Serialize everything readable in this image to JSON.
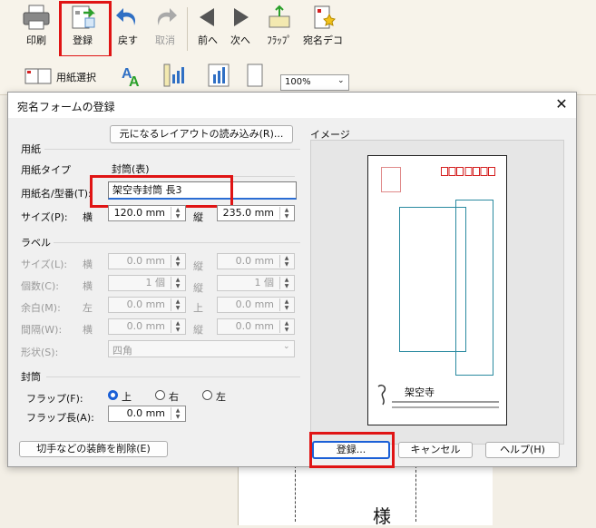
{
  "toolbar": {
    "print": "印刷",
    "register": "登録",
    "undo": "戻す",
    "cancel": "取消",
    "prev": "前へ",
    "next": "次へ",
    "flap": "ﾌﾗｯﾌﾟ",
    "deco": "宛名デコ",
    "paper_select": "用紙選択",
    "zoom": "100%"
  },
  "dialog": {
    "title": "宛名フォームの登録",
    "load_layout_button": "元になるレイアウトの読み込み(R)...",
    "image_label": "イメージ",
    "paper": {
      "group": "用紙",
      "type_label": "用紙タイプ",
      "type_value": "封筒(表)",
      "name_label": "用紙名/型番(T):",
      "name_value": "架空寺封筒 長3",
      "size_label": "サイズ(P):",
      "w_label": "横",
      "w_value": "120.0 mm",
      "h_label": "縦",
      "h_value": "235.0 mm"
    },
    "label": {
      "group": "ラベル",
      "size_label": "サイズ(L):",
      "count_label": "個数(C):",
      "margin_label": "余白(M):",
      "gap_label": "間隔(W):",
      "shape_label": "形状(S):",
      "yoko": "横",
      "tate": "縦",
      "left": "左",
      "top": "上",
      "size_w": "0.0 mm",
      "size_h": "0.0 mm",
      "count_w": "1 個",
      "count_h": "1 個",
      "margin_l": "0.0 mm",
      "margin_t": "0.0 mm",
      "gap_w": "0.0 mm",
      "gap_h": "0.0 mm",
      "shape_value": "四角"
    },
    "envelope": {
      "group": "封筒",
      "flap_label": "フラップ(F):",
      "opt_top": "上",
      "opt_right": "右",
      "opt_left": "左",
      "flap_len_label": "フラップ長(A):",
      "flap_len_value": "0.0 mm"
    },
    "remove_deco_button": "切手などの装飾を削除(E)",
    "register_button": "登録...",
    "cancel_button": "キャンセル",
    "help_button": "ヘルプ(H)",
    "preview_sender_text": "架空寺"
  },
  "background": {
    "sama": "様"
  },
  "colors": {
    "accent": "#1a5fd6",
    "highlight": "#e01414",
    "postal_box": "#d42020",
    "frame": "#2a8aa0"
  }
}
